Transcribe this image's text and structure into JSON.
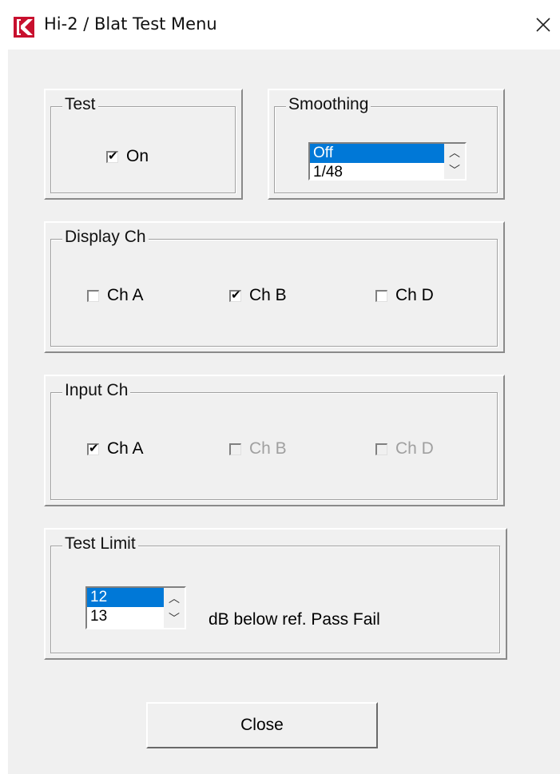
{
  "window": {
    "title": "Hi-2 / Blat Test Menu",
    "close_glyph": "✕"
  },
  "test": {
    "legend": "Test",
    "on_label": "On",
    "on_checked": true
  },
  "smoothing": {
    "legend": "Smoothing",
    "items": [
      "Off",
      "1/48"
    ],
    "selected": "Off"
  },
  "display_ch": {
    "legend": "Display Ch",
    "channels": [
      {
        "label": "Ch A",
        "checked": false
      },
      {
        "label": "Ch B",
        "checked": true
      },
      {
        "label": "Ch D",
        "checked": false
      }
    ]
  },
  "input_ch": {
    "legend": "Input Ch",
    "channels": [
      {
        "label": "Ch A",
        "checked": true,
        "enabled": true
      },
      {
        "label": "Ch B",
        "checked": false,
        "enabled": false
      },
      {
        "label": "Ch D",
        "checked": false,
        "enabled": false
      }
    ]
  },
  "test_limit": {
    "legend": "Test Limit",
    "items": [
      "12",
      "13"
    ],
    "selected": "12",
    "unit_text": "dB below ref. Pass Fail"
  },
  "buttons": {
    "close_label": "Close"
  },
  "colors": {
    "accent": "#0078d7",
    "background": "#f0f0f0"
  },
  "icons": {
    "app": "app-logo-icon",
    "spin_up": "chevron-up-icon",
    "spin_down": "chevron-down-icon"
  }
}
